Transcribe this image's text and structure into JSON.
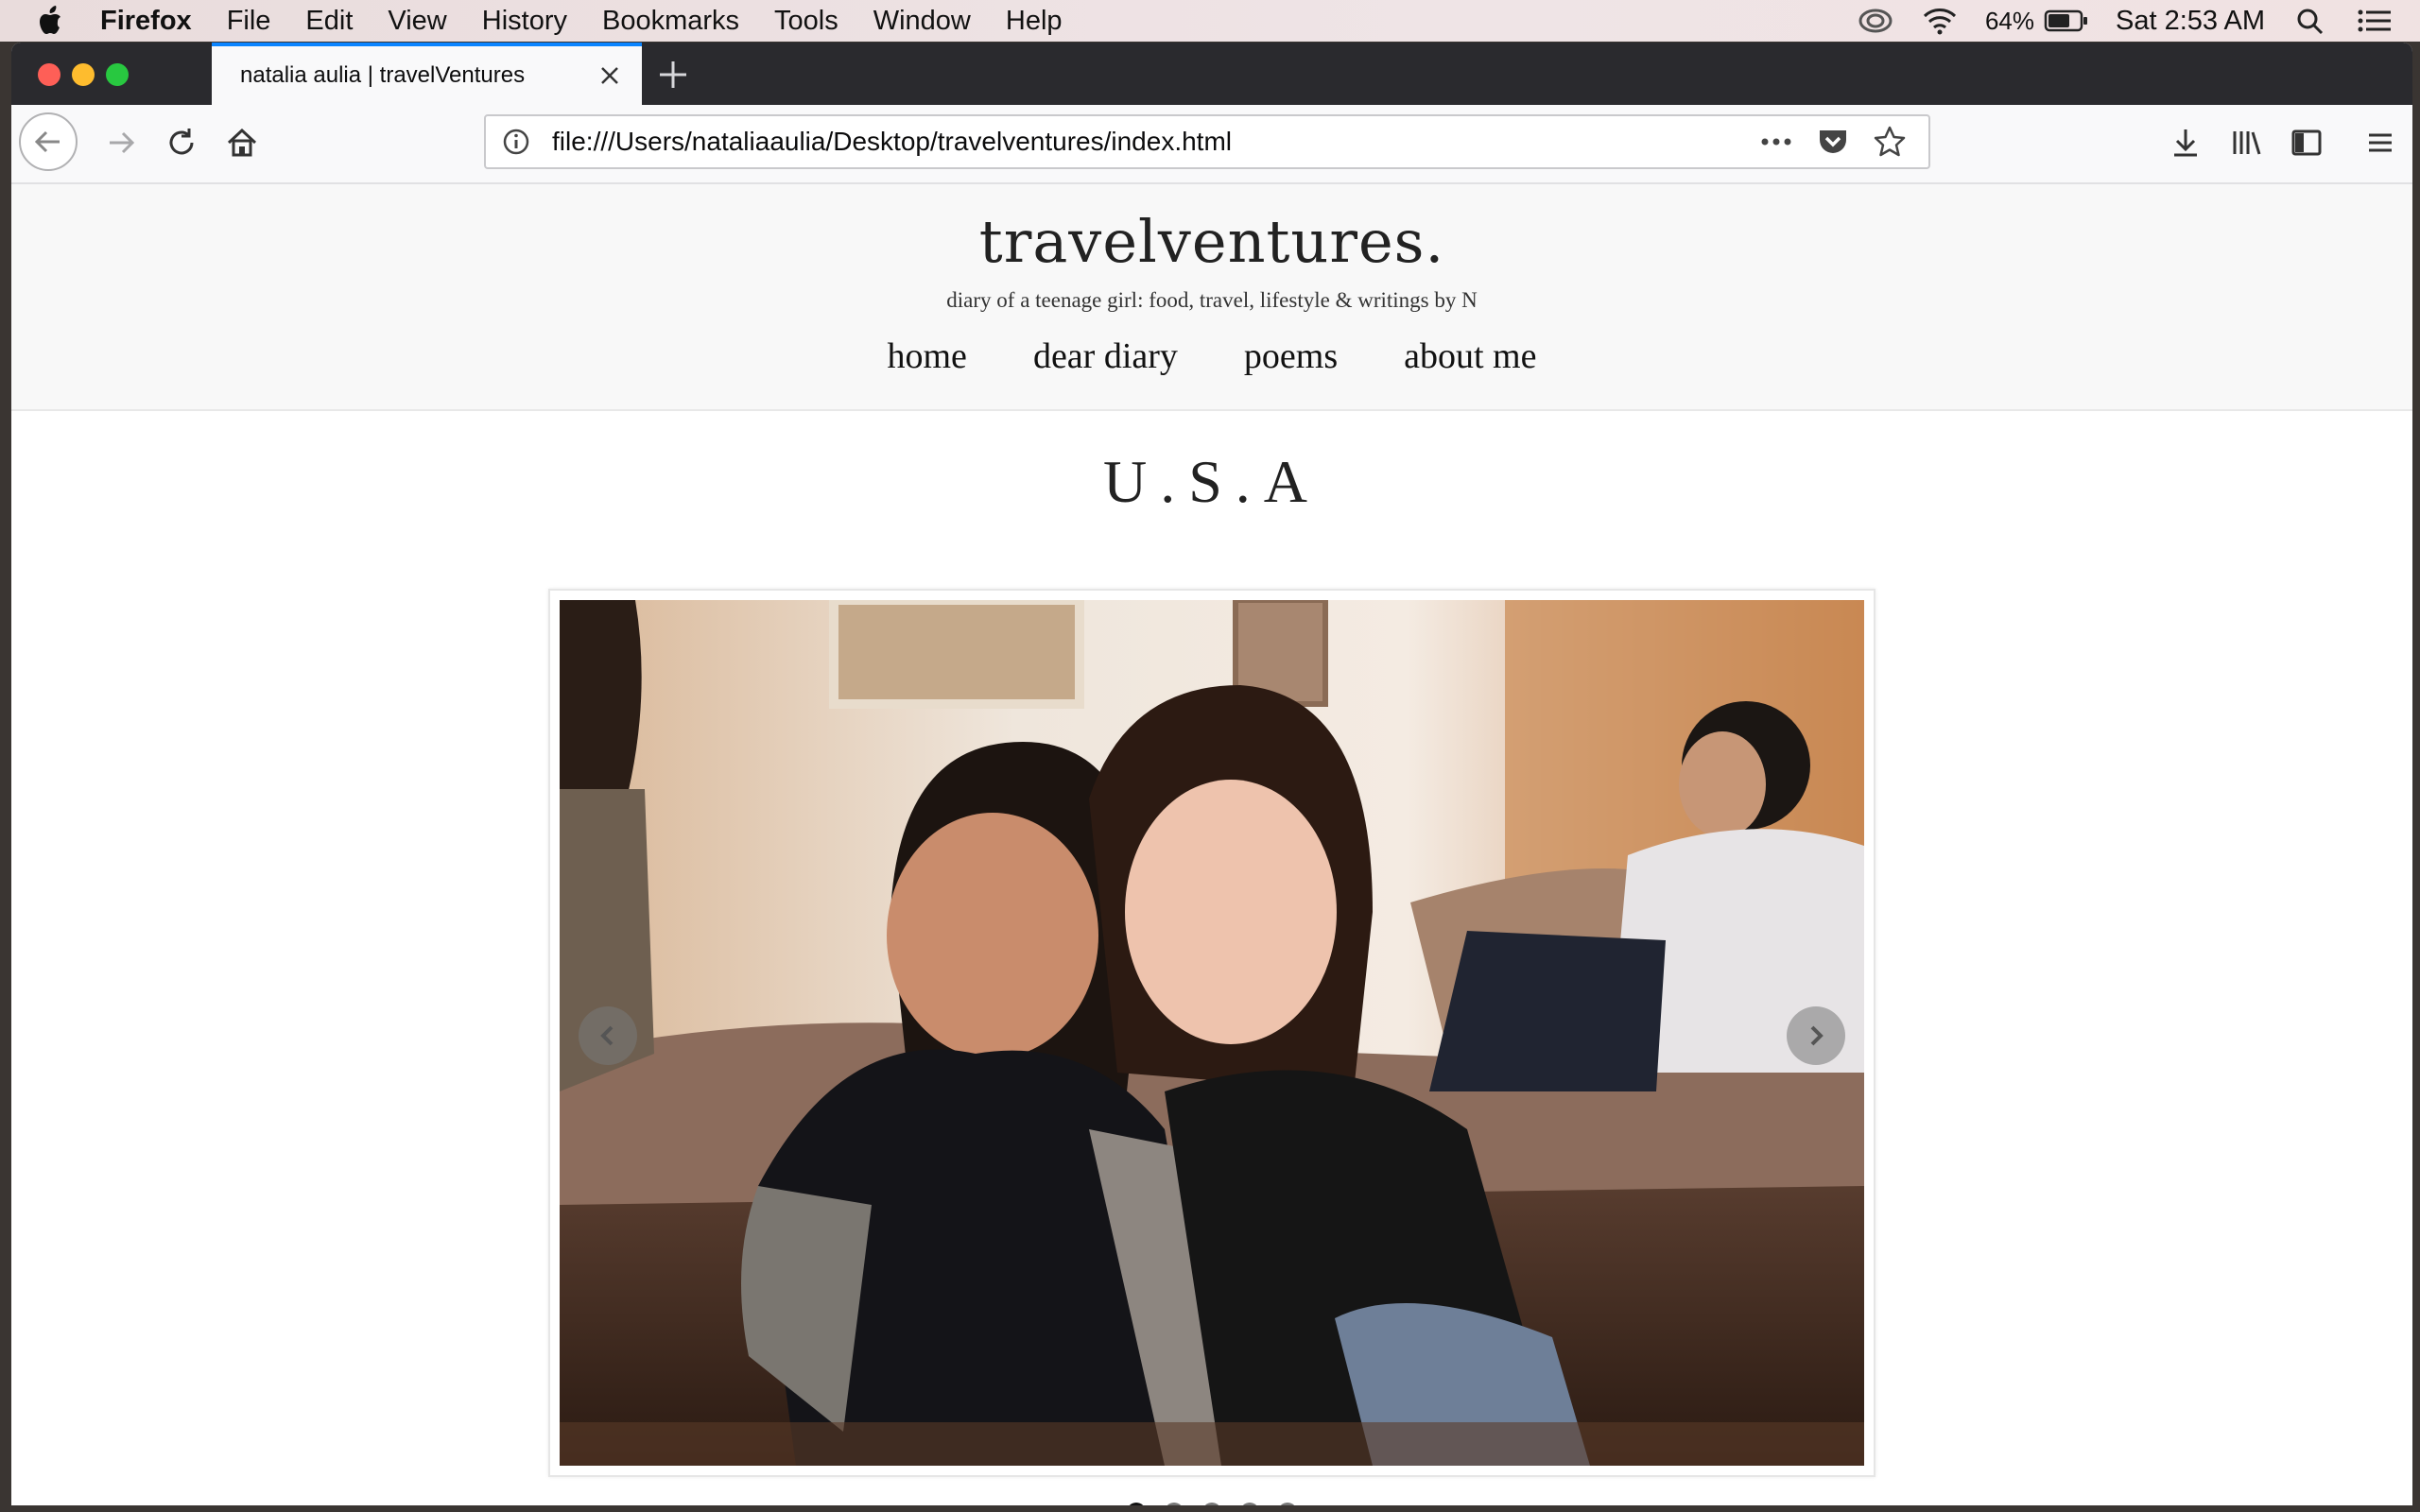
{
  "menubar": {
    "app": "Firefox",
    "items": [
      "File",
      "Edit",
      "View",
      "History",
      "Bookmarks",
      "Tools",
      "Window",
      "Help"
    ],
    "battery": "64%",
    "clock": "Sat 2:53 AM"
  },
  "browser": {
    "tab_title": "natalia aulia | travelVentures",
    "url": "file:///Users/nataliaaulia/Desktop/travelventures/index.html"
  },
  "site": {
    "title": "travelventures.",
    "tagline": "diary of a teenage girl: food, travel, lifestyle & writings by N",
    "nav": [
      "home",
      "dear diary",
      "poems",
      "about me"
    ]
  },
  "content": {
    "heading": "U.S.A",
    "slide_count": 5,
    "active_slide": 1
  },
  "colors": {
    "tab_accent": "#0a84ff",
    "header_bg": "#f8f8f8",
    "dot_active": "#111111",
    "dot_inactive": "#777777"
  }
}
